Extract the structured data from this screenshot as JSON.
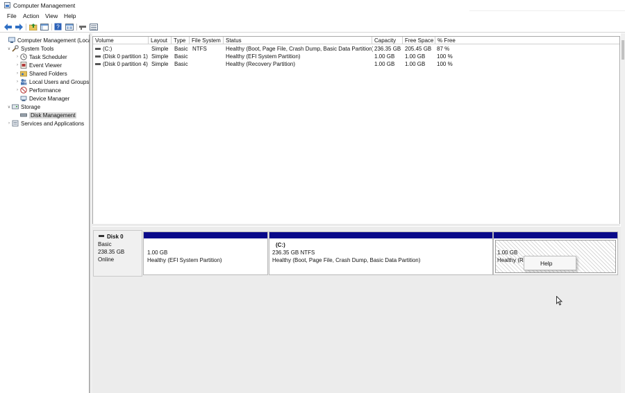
{
  "window": {
    "title": "Computer Management"
  },
  "menubar": {
    "items": [
      "File",
      "Action",
      "View",
      "Help"
    ]
  },
  "toolbar": {
    "buttons": [
      "back-icon",
      "forward-icon",
      "up-folder-icon",
      "show-hide-tree-icon",
      "help-icon",
      "properties-icon",
      "disk-icon",
      "settings-list-icon"
    ]
  },
  "tree": {
    "items": [
      {
        "label": "Computer Management (Local)",
        "icon": "computer-management-icon"
      },
      {
        "label": "System Tools",
        "icon": "tools-icon"
      },
      {
        "label": "Task Scheduler",
        "icon": "clock-icon"
      },
      {
        "label": "Event Viewer",
        "icon": "event-viewer-icon"
      },
      {
        "label": "Shared Folders",
        "icon": "shared-folder-icon"
      },
      {
        "label": "Local Users and Groups",
        "icon": "users-icon"
      },
      {
        "label": "Performance",
        "icon": "performance-icon"
      },
      {
        "label": "Device Manager",
        "icon": "device-manager-icon"
      },
      {
        "label": "Storage",
        "icon": "storage-icon"
      },
      {
        "label": "Disk Management",
        "icon": "disk-management-icon"
      },
      {
        "label": "Services and Applications",
        "icon": "services-icon"
      }
    ]
  },
  "volumes": {
    "columns": [
      "Volume",
      "Layout",
      "Type",
      "File System",
      "Status",
      "Capacity",
      "Free Space",
      "% Free"
    ],
    "rows": [
      [
        "(C:)",
        "Simple",
        "Basic",
        "NTFS",
        "Healthy (Boot, Page File, Crash Dump, Basic Data Partition)",
        "236.35 GB",
        "205.45 GB",
        "87 %"
      ],
      [
        "(Disk 0 partition 1)",
        "Simple",
        "Basic",
        "",
        "Healthy (EFI System Partition)",
        "1.00 GB",
        "1.00 GB",
        "100 %"
      ],
      [
        "(Disk 0 partition 4)",
        "Simple",
        "Basic",
        "",
        "Healthy (Recovery Partition)",
        "1.00 GB",
        "1.00 GB",
        "100 %"
      ]
    ]
  },
  "disk": {
    "name": "Disk 0",
    "type": "Basic",
    "size": "238.35 GB",
    "status": "Online",
    "partitions": [
      {
        "title": "",
        "size": "1.00 GB",
        "status": "Healthy (EFI System Partition)"
      },
      {
        "title": "(C:)",
        "size": "236.35 GB NTFS",
        "status": "Healthy (Boot, Page File, Crash Dump, Basic Data Partition)"
      },
      {
        "title": "",
        "size": "1.00 GB",
        "status": "Healthy (Re"
      }
    ]
  },
  "context_menu": {
    "items": [
      "Help"
    ]
  },
  "colors": {
    "partition_bar": "#0a0a8a",
    "selection": "#d9d9d9"
  }
}
